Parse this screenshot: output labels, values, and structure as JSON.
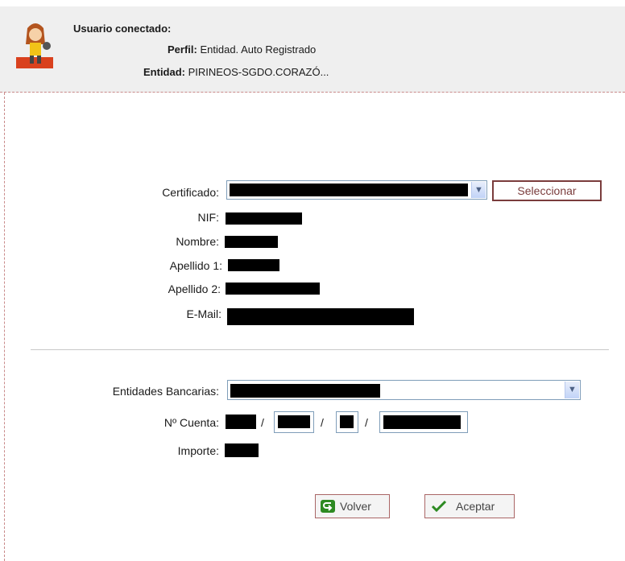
{
  "header": {
    "title": "Usuario conectado:",
    "perfil_label": "Perfil:",
    "perfil_value": "Entidad. Auto Registrado",
    "entidad_label": "Entidad:",
    "entidad_value": "PIRINEOS-SGDO.CORAZÓ..."
  },
  "form": {
    "certificado_label": "Certificado:",
    "seleccionar_label": "Seleccionar",
    "nif_label": "NIF:",
    "nombre_label": "Nombre:",
    "apellido1_label": "Apellido 1:",
    "apellido2_label": "Apellido 2:",
    "email_label": "E-Mail:",
    "entidades_label": "Entidades Bancarias:",
    "cuenta_label": "Nº Cuenta:",
    "cuenta_sep": "/",
    "importe_label": "Importe:"
  },
  "actions": {
    "volver_label": "Volver",
    "aceptar_label": "Aceptar"
  },
  "colors": {
    "header_bg": "#efefef",
    "accent": "#7a3c3c",
    "field_border": "#7f9db9"
  },
  "icons": [
    "user-avatar-icon",
    "dropdown-arrow-icon",
    "volver-arrow-icon",
    "checkmark-icon"
  ]
}
